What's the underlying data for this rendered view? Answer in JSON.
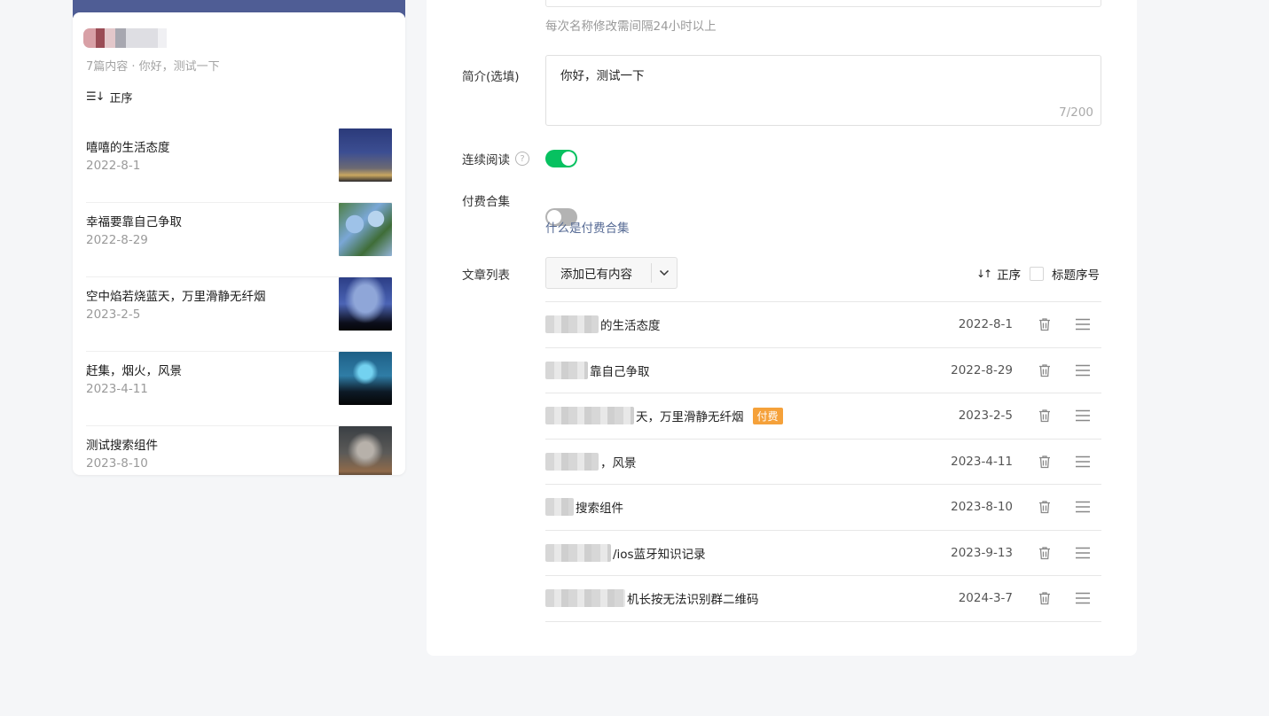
{
  "preview": {
    "meta": "7篇内容 · 你好，测试一下",
    "sort_label": "正序",
    "articles": [
      {
        "title": "嘻嘻的生活态度",
        "date": "2022-8-1"
      },
      {
        "title": "幸福要靠自己争取",
        "date": "2022-8-29"
      },
      {
        "title": "空中焰若烧蓝天，万里滑静无纤烟",
        "date": "2023-2-5"
      },
      {
        "title": "赶集，烟火，风景",
        "date": "2023-4-11"
      },
      {
        "title": "测试搜索组件",
        "date": "2023-8-10"
      }
    ]
  },
  "settings": {
    "name_hint": "每次名称修改需间隔24小时以上",
    "desc_label": "简介(选填)",
    "desc_value": "你好，测试一下",
    "desc_count": "7/200",
    "continuous_label": "连续阅读",
    "help_glyph": "?",
    "continuous_on": true,
    "paid_label": "付费合集",
    "paid_on": false,
    "paid_link": "什么是付费合集",
    "list_label": "文章列表",
    "add_button": "添加已有内容",
    "sort_label": "正序",
    "serial_label": "标题序号",
    "serial_checked": false,
    "rows": [
      {
        "title_visible": "的生活态度",
        "date": "2022-8-1",
        "badge": ""
      },
      {
        "title_visible": "靠自己争取",
        "date": "2022-8-29",
        "badge": ""
      },
      {
        "title_visible": "天，万里滑静无纤烟",
        "date": "2023-2-5",
        "badge": "付费"
      },
      {
        "title_visible": "，风景",
        "date": "2023-4-11",
        "badge": ""
      },
      {
        "title_visible": "搜索组件",
        "date": "2023-8-10",
        "badge": ""
      },
      {
        "title_visible": "/ios蓝牙知识记录",
        "date": "2023-9-13",
        "badge": ""
      },
      {
        "title_visible": "机长按无法识别群二维码",
        "date": "2024-3-7",
        "badge": ""
      }
    ]
  },
  "colors": {
    "accent_green": "#07c160",
    "link_blue": "#576b95",
    "badge_orange": "#f5a13a",
    "header_navy": "#4f5d95"
  },
  "icons": {
    "sort": "sort-icon",
    "delete": "trash-icon",
    "drag": "drag-handle-icon",
    "chevron": "chevron-down-icon",
    "help": "help-icon"
  }
}
